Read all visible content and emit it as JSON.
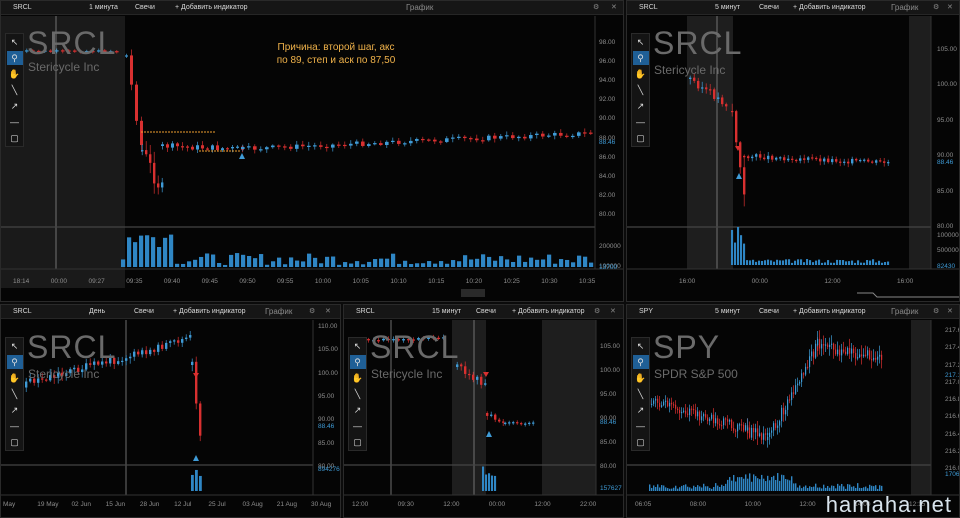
{
  "common": {
    "settings_icon": "gear-icon",
    "close_icon": "close-icon",
    "add_indicator": "+ Добавить индикатор",
    "type": "Свечи",
    "title": "График"
  },
  "toolbar_icons": [
    "cursor-icon",
    "zoom-icon",
    "hand-icon",
    "line-icon",
    "arrow-icon",
    "hline-icon",
    "rect-icon"
  ],
  "annotation": "Причина: второй шаг, акс по 89, степ и аск по 87,50",
  "brand": "hamaha.net",
  "panels": [
    {
      "ticker": "SRCL",
      "interval": "1 минута",
      "name": "Stericycle Inc",
      "yticks": [
        "98.00",
        "96.00",
        "94.00",
        "92.00",
        "90.00",
        "88.00",
        "86.00",
        "84.00",
        "82.00",
        "80.00"
      ],
      "price_hl": "88.46",
      "vol_ticks": [
        "200000",
        "100000"
      ],
      "vol_hl": "13700",
      "xticks": [
        "18:14",
        "00:00",
        "09:27",
        "09:35",
        "09:40",
        "09:45",
        "09:50",
        "09:55",
        "10:00",
        "10:05",
        "10:10",
        "10:15",
        "10:20",
        "10:25",
        "10:30",
        "10:35"
      ]
    },
    {
      "ticker": "SRCL",
      "interval": "5 минут",
      "name": "Stericycle Inc",
      "yticks": [
        "105.00",
        "100.00",
        "95.00",
        "90.00",
        "85.00",
        "80.00"
      ],
      "price_hl": "88.46",
      "vol_ticks": [
        "1000000",
        "500000"
      ],
      "vol_hl": "82430",
      "xticks": [
        "16:00",
        "00:00",
        "12:00",
        "16:00"
      ]
    },
    {
      "ticker": "SRCL",
      "interval": "День",
      "name": "Stericycle Inc",
      "yticks": [
        "110.00",
        "105.00",
        "100.00",
        "95.00",
        "90.00",
        "85.00",
        "80.00"
      ],
      "price_hl": "88.46",
      "vol_ticks": [],
      "vol_hl": "8942761",
      "xticks": [
        "May",
        "19 May",
        "02 Jun",
        "15 Jun",
        "28 Jun",
        "12 Jul",
        "25 Jul",
        "03 Aug",
        "21 Aug",
        "30 Aug"
      ]
    },
    {
      "ticker": "SRCL",
      "interval": "15 минут",
      "name": "Stericycle Inc",
      "yticks": [
        "105.00",
        "100.00",
        "95.00",
        "90.00",
        "85.00",
        "80.00"
      ],
      "price_hl": "88.46",
      "vol_ticks": [],
      "vol_hl": "157627",
      "xticks": [
        "12:00",
        "09:30",
        "12:00",
        "00:00",
        "12:00",
        "22:00"
      ]
    },
    {
      "ticker": "SPY",
      "interval": "5 минут",
      "name": "SPDR S&P 500",
      "yticks": [
        "217.60",
        "217.40",
        "217.20",
        "217.00",
        "216.80",
        "216.60",
        "216.40",
        "216.20",
        "216.00"
      ],
      "price_hl": "217.12",
      "vol_ticks": [],
      "vol_hl": "17060",
      "xticks": [
        "06:05",
        "08:00",
        "10:00",
        "12:00",
        "14:00",
        "12:15"
      ]
    }
  ]
}
